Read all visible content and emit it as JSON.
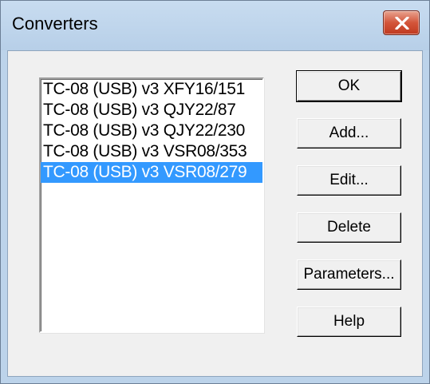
{
  "window": {
    "title": "Converters",
    "close_icon": "close-icon"
  },
  "converters": {
    "items": [
      "TC-08 (USB) v3 XFY16/151",
      "TC-08 (USB) v3 QJY22/87",
      "TC-08 (USB) v3 QJY22/230",
      "TC-08 (USB) v3 VSR08/353",
      "TC-08 (USB) v3 VSR08/279"
    ],
    "selected_index": 4
  },
  "buttons": {
    "ok": "OK",
    "add": "Add...",
    "edit": "Edit...",
    "delete": "Delete",
    "parameters": "Parameters...",
    "help": "Help"
  },
  "colors": {
    "selection": "#3399ff",
    "close_button": "#c0391f"
  }
}
